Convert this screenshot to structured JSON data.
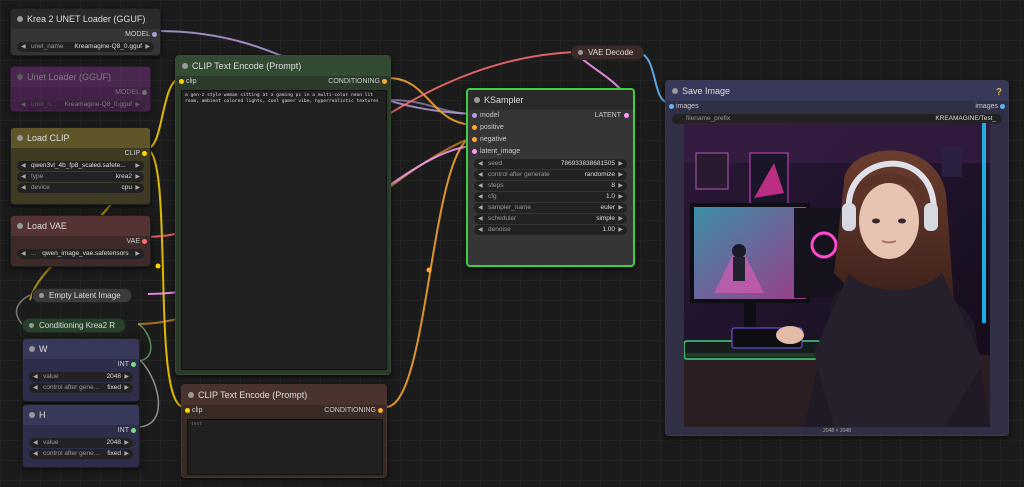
{
  "nodes": {
    "unet_loader": {
      "title": "Krea 2 UNET Loader (GGUF)",
      "output": "MODEL",
      "widget": {
        "name": "unet_name",
        "value": "Kreamagine-Q8_0.gguf"
      }
    },
    "unet_loader_bypassed": {
      "title": "Unet Loader (GGUF)",
      "output": "MODEL",
      "widget": {
        "name": "unet_n...",
        "value": "Kreamagine-Q8_0.gguf"
      }
    },
    "load_clip": {
      "title": "Load CLIP",
      "output": "CLIP",
      "widgets": [
        {
          "name": "",
          "value": "qwen3vl_4b_fp8_scaled.safete..."
        },
        {
          "name": "type",
          "value": "krea2"
        },
        {
          "name": "device",
          "value": "cpu"
        }
      ]
    },
    "load_vae": {
      "title": "Load VAE",
      "output": "VAE",
      "widget": {
        "name": "...",
        "value": "qwen_image_vae.safetensors"
      }
    },
    "empty_latent": {
      "title": "Empty Latent Image"
    },
    "conditioning": {
      "title": "Conditioning Krea2 R"
    },
    "w_node": {
      "title": "W",
      "output": "INT",
      "widgets": [
        {
          "name": "value",
          "value": "2048"
        },
        {
          "name": "control after gene...",
          "value": "fixed"
        }
      ]
    },
    "h_node": {
      "title": "H",
      "output": "INT",
      "widgets": [
        {
          "name": "value",
          "value": "2048"
        },
        {
          "name": "control after gene...",
          "value": "fixed"
        }
      ]
    },
    "clip_text_pos": {
      "title": "CLIP Text Encode (Prompt)",
      "input": "clip",
      "output": "CONDITIONING",
      "text": "a gen-z style woman sitting at a gaming pc in a multi-color neon lit room, ambient colored lights, cool gamer vibe, hyperrealistic textures"
    },
    "clip_text_neg": {
      "title": "CLIP Text Encode (Prompt)",
      "input": "clip",
      "output": "CONDITIONING",
      "placeholder": "text"
    },
    "ksampler": {
      "title": "KSampler",
      "inputs": [
        "model",
        "positive",
        "negative",
        "latent_image"
      ],
      "output": "LATENT",
      "widgets": [
        {
          "name": "seed",
          "value": "786933838681505"
        },
        {
          "name": "control after generate",
          "value": "randomize"
        },
        {
          "name": "steps",
          "value": "8"
        },
        {
          "name": "cfg",
          "value": "1.0"
        },
        {
          "name": "sampler_name",
          "value": "euler"
        },
        {
          "name": "scheduler",
          "value": "simple"
        },
        {
          "name": "denoise",
          "value": "1.00"
        }
      ]
    },
    "vae_decode": {
      "title": "VAE Decode"
    },
    "save_image": {
      "title": "Save Image",
      "input": "images",
      "output": "images",
      "help": "?",
      "widget": {
        "name": "filename_prefix",
        "value": "KREAMAGINE/Test_"
      },
      "caption": "2048 × 2048"
    }
  },
  "colors": {
    "canvas": "#1b1b1b",
    "node_body": "#353535",
    "clip_yellow": "#ffd500",
    "cond_orange": "#ffa931",
    "model_lavender": "#b39ddb",
    "latent_pink": "#ff9cf9",
    "vae_red": "#ff6e6e",
    "image_blue": "#64b5f6",
    "int_green": "#7cdc82",
    "selected_green": "#3ecf3e"
  }
}
